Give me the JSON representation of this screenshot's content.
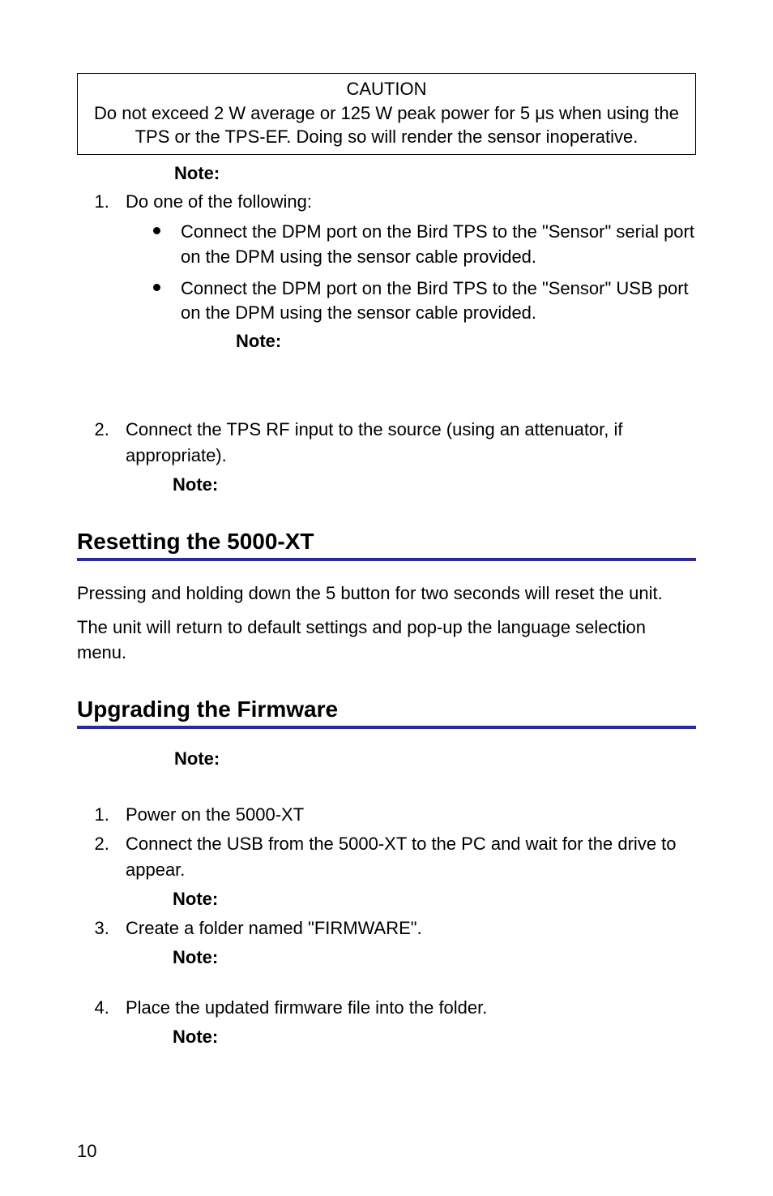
{
  "caution": {
    "title": "CAUTION",
    "body": "Do not exceed 2 W average or 125 W peak power for 5 μs when using the TPS or the TPS-EF. Doing so will render the sensor inoperative."
  },
  "labels": {
    "note": "Note:"
  },
  "list1": {
    "item1_intro": "Do one of the following:",
    "bullet1": "Connect the DPM port on the Bird TPS to the \"Sensor\" serial port on the DPM using the sensor cable provided.",
    "bullet2": "Connect the DPM port on the Bird TPS to the \"Sensor\" USB port on the DPM using the sensor cable provided.",
    "item2": "Connect the TPS RF input to the source (using an attenuator, if appropriate)."
  },
  "section_reset": {
    "heading": "Resetting the 5000-XT",
    "p1": "Pressing and holding down the 5 button for two seconds will reset the unit.",
    "p2": "The unit will return to default settings and pop-up the language selection menu."
  },
  "section_fw": {
    "heading": "Upgrading the Firmware",
    "step1": "Power on the 5000-XT",
    "step2": "Connect the USB from the 5000-XT to the PC and wait for the drive to appear.",
    "step3": "Create a folder named \"FIRMWARE\".",
    "step4": "Place the updated firmware file into the folder."
  },
  "page_number": "10"
}
